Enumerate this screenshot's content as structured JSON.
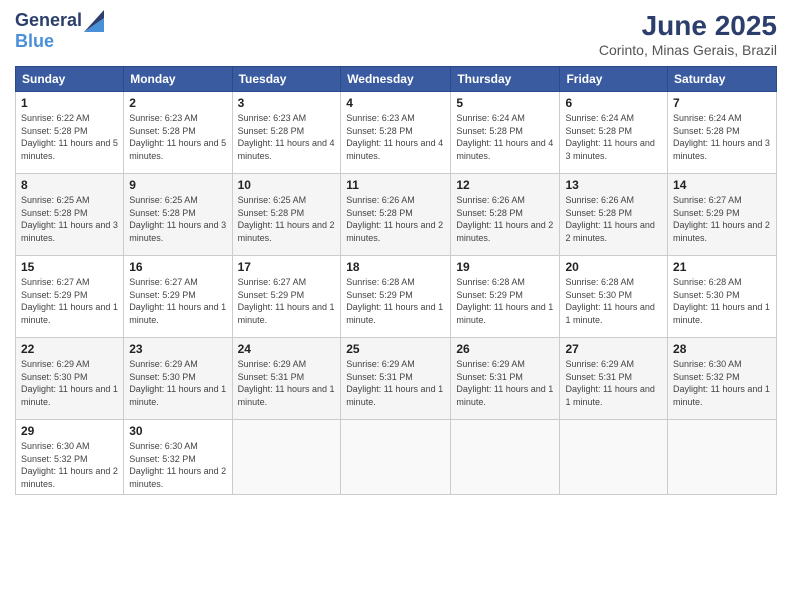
{
  "logo": {
    "line1": "General",
    "line2": "Blue"
  },
  "title": "June 2025",
  "subtitle": "Corinto, Minas Gerais, Brazil",
  "days_header": [
    "Sunday",
    "Monday",
    "Tuesday",
    "Wednesday",
    "Thursday",
    "Friday",
    "Saturday"
  ],
  "weeks": [
    [
      {
        "num": "1",
        "sunrise": "6:22 AM",
        "sunset": "5:28 PM",
        "daylight": "11 hours and 5 minutes."
      },
      {
        "num": "2",
        "sunrise": "6:23 AM",
        "sunset": "5:28 PM",
        "daylight": "11 hours and 5 minutes."
      },
      {
        "num": "3",
        "sunrise": "6:23 AM",
        "sunset": "5:28 PM",
        "daylight": "11 hours and 4 minutes."
      },
      {
        "num": "4",
        "sunrise": "6:23 AM",
        "sunset": "5:28 PM",
        "daylight": "11 hours and 4 minutes."
      },
      {
        "num": "5",
        "sunrise": "6:24 AM",
        "sunset": "5:28 PM",
        "daylight": "11 hours and 4 minutes."
      },
      {
        "num": "6",
        "sunrise": "6:24 AM",
        "sunset": "5:28 PM",
        "daylight": "11 hours and 3 minutes."
      },
      {
        "num": "7",
        "sunrise": "6:24 AM",
        "sunset": "5:28 PM",
        "daylight": "11 hours and 3 minutes."
      }
    ],
    [
      {
        "num": "8",
        "sunrise": "6:25 AM",
        "sunset": "5:28 PM",
        "daylight": "11 hours and 3 minutes."
      },
      {
        "num": "9",
        "sunrise": "6:25 AM",
        "sunset": "5:28 PM",
        "daylight": "11 hours and 3 minutes."
      },
      {
        "num": "10",
        "sunrise": "6:25 AM",
        "sunset": "5:28 PM",
        "daylight": "11 hours and 2 minutes."
      },
      {
        "num": "11",
        "sunrise": "6:26 AM",
        "sunset": "5:28 PM",
        "daylight": "11 hours and 2 minutes."
      },
      {
        "num": "12",
        "sunrise": "6:26 AM",
        "sunset": "5:28 PM",
        "daylight": "11 hours and 2 minutes."
      },
      {
        "num": "13",
        "sunrise": "6:26 AM",
        "sunset": "5:28 PM",
        "daylight": "11 hours and 2 minutes."
      },
      {
        "num": "14",
        "sunrise": "6:27 AM",
        "sunset": "5:29 PM",
        "daylight": "11 hours and 2 minutes."
      }
    ],
    [
      {
        "num": "15",
        "sunrise": "6:27 AM",
        "sunset": "5:29 PM",
        "daylight": "11 hours and 1 minute."
      },
      {
        "num": "16",
        "sunrise": "6:27 AM",
        "sunset": "5:29 PM",
        "daylight": "11 hours and 1 minute."
      },
      {
        "num": "17",
        "sunrise": "6:27 AM",
        "sunset": "5:29 PM",
        "daylight": "11 hours and 1 minute."
      },
      {
        "num": "18",
        "sunrise": "6:28 AM",
        "sunset": "5:29 PM",
        "daylight": "11 hours and 1 minute."
      },
      {
        "num": "19",
        "sunrise": "6:28 AM",
        "sunset": "5:29 PM",
        "daylight": "11 hours and 1 minute."
      },
      {
        "num": "20",
        "sunrise": "6:28 AM",
        "sunset": "5:30 PM",
        "daylight": "11 hours and 1 minute."
      },
      {
        "num": "21",
        "sunrise": "6:28 AM",
        "sunset": "5:30 PM",
        "daylight": "11 hours and 1 minute."
      }
    ],
    [
      {
        "num": "22",
        "sunrise": "6:29 AM",
        "sunset": "5:30 PM",
        "daylight": "11 hours and 1 minute."
      },
      {
        "num": "23",
        "sunrise": "6:29 AM",
        "sunset": "5:30 PM",
        "daylight": "11 hours and 1 minute."
      },
      {
        "num": "24",
        "sunrise": "6:29 AM",
        "sunset": "5:31 PM",
        "daylight": "11 hours and 1 minute."
      },
      {
        "num": "25",
        "sunrise": "6:29 AM",
        "sunset": "5:31 PM",
        "daylight": "11 hours and 1 minute."
      },
      {
        "num": "26",
        "sunrise": "6:29 AM",
        "sunset": "5:31 PM",
        "daylight": "11 hours and 1 minute."
      },
      {
        "num": "27",
        "sunrise": "6:29 AM",
        "sunset": "5:31 PM",
        "daylight": "11 hours and 1 minute."
      },
      {
        "num": "28",
        "sunrise": "6:30 AM",
        "sunset": "5:32 PM",
        "daylight": "11 hours and 1 minute."
      }
    ],
    [
      {
        "num": "29",
        "sunrise": "6:30 AM",
        "sunset": "5:32 PM",
        "daylight": "11 hours and 2 minutes."
      },
      {
        "num": "30",
        "sunrise": "6:30 AM",
        "sunset": "5:32 PM",
        "daylight": "11 hours and 2 minutes."
      },
      null,
      null,
      null,
      null,
      null
    ]
  ]
}
